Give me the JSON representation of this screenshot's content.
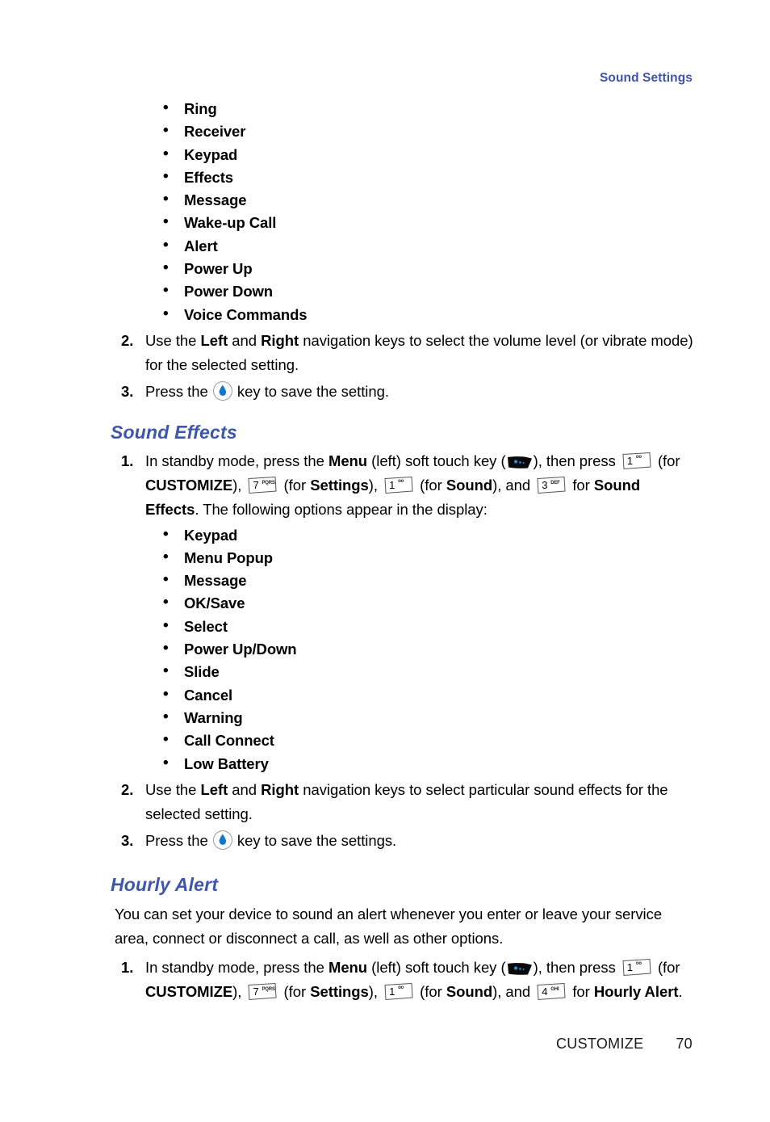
{
  "header": {
    "running_head": "Sound Settings",
    "accent_color": "#4054A6"
  },
  "sections": {
    "volume_list": {
      "items": [
        "Ring",
        "Receiver",
        "Keypad",
        "Effects",
        "Message",
        "Wake-up Call",
        "Alert",
        "Power Up",
        "Power Down",
        "Voice Commands"
      ]
    },
    "volume_steps": {
      "step2": {
        "num": "2.",
        "t1": "Use the ",
        "b1": "Left",
        "t2": " and ",
        "b2": "Right",
        "t3": " navigation keys to select the volume level (or vibrate mode) for the selected setting."
      },
      "step3": {
        "num": "3.",
        "t1": "Press the ",
        "t2": " key to save the setting."
      }
    },
    "sound_effects": {
      "heading": "Sound Effects",
      "step1": {
        "num": "1.",
        "t1": "In standby mode, press the ",
        "b1": "Menu",
        "t2": " (left) soft touch key (",
        "t3": "), then press ",
        "t4": " (for ",
        "b2": "CUSTOMIZE",
        "t5": "), ",
        "t6": " (for ",
        "b3": "Settings",
        "t7": "), ",
        "t8": " (for ",
        "b4": "Sound",
        "t9": "), and ",
        "t10": " for ",
        "b5": "Sound Effects",
        "t11": ". The following options appear in the display:"
      },
      "items": [
        "Keypad",
        "Menu Popup",
        "Message",
        "OK/Save",
        "Select",
        "Power Up/Down",
        "Slide",
        "Cancel",
        "Warning",
        "Call Connect",
        "Low Battery"
      ],
      "step2": {
        "num": "2.",
        "t1": "Use the ",
        "b1": "Left",
        "t2": " and ",
        "b2": "Right",
        "t3": " navigation keys to select particular sound effects for the selected setting."
      },
      "step3": {
        "num": "3.",
        "t1": "Press the ",
        "t2": " key to save the settings."
      }
    },
    "hourly_alert": {
      "heading": "Hourly Alert",
      "intro": "You can set your device to sound an alert whenever you enter or leave your service area, connect or disconnect a call, as well as other options.",
      "step1": {
        "num": "1.",
        "t1": "In standby mode, press the ",
        "b1": "Menu",
        "t2": " (left) soft touch key (",
        "t3": "), then press ",
        "t4": " (for ",
        "b2": "CUSTOMIZE",
        "t5": "), ",
        "t6": " (for ",
        "b3": "Settings",
        "t7": "), ",
        "t8": " (for ",
        "b4": "Sound",
        "t9": "), and ",
        "t10": " for ",
        "b5": "Hourly Alert",
        "t11": "."
      }
    }
  },
  "keys": {
    "one": {
      "digit": "1",
      "letters": "oo"
    },
    "three": {
      "digit": "3",
      "letters": "DEF"
    },
    "four": {
      "digit": "4",
      "letters": "GHI"
    },
    "seven": {
      "digit": "7",
      "letters": "PQRS"
    }
  },
  "footer": {
    "chapter": "CUSTOMIZE",
    "page": "70"
  }
}
